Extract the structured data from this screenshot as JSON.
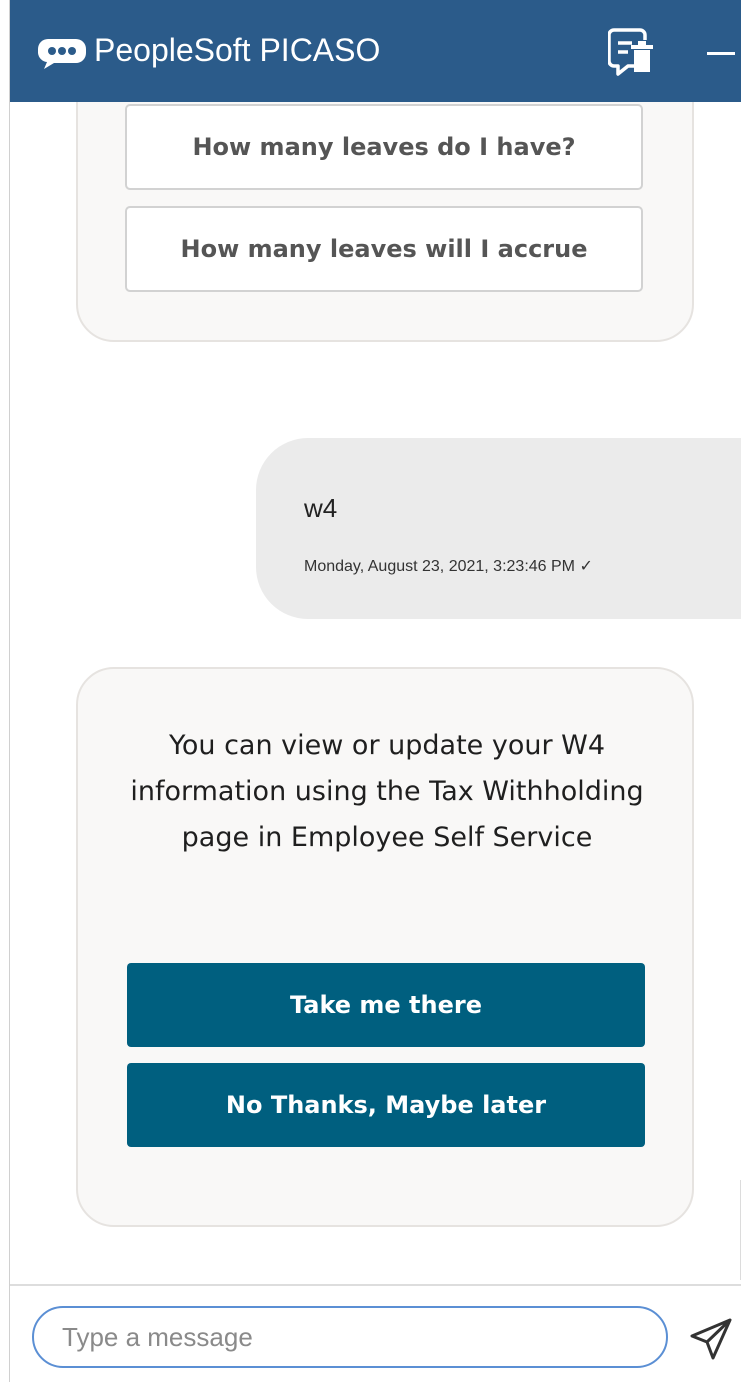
{
  "header": {
    "title": "PeopleSoft PICASO",
    "bg_color": "#2b5b8a",
    "logo_icon": "chat-bubble-icon",
    "clear_icon": "clear-conversation-icon",
    "minimize_icon": "minimize-icon"
  },
  "chat": {
    "bot_quick_replies": [
      {
        "label": "How many leaves do I have?"
      },
      {
        "label": "How many leaves will I accrue"
      }
    ],
    "user_message": {
      "text": "w4",
      "timestamp": "Monday, August 23, 2021, 3:23:46 PM ✓"
    },
    "bot_response": {
      "text": "You can view or update your W4 information using the Tax Withholding page in Employee Self Service",
      "actions": [
        {
          "label": "Take me there"
        },
        {
          "label": "No Thanks, Maybe later"
        }
      ],
      "action_color": "#005f7f"
    }
  },
  "composer": {
    "placeholder": "Type a message",
    "value": "",
    "send_icon": "send-icon"
  }
}
